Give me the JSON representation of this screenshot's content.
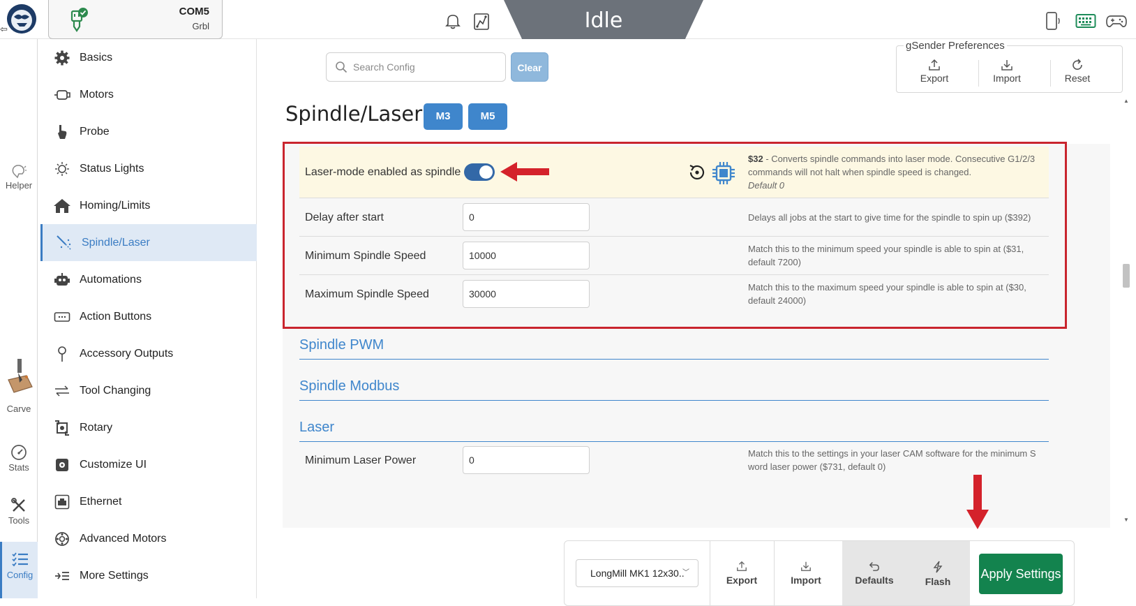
{
  "header": {
    "com_port": "COM5",
    "firmware": "Grbl",
    "machine_state": "Idle",
    "icons": [
      "bell-icon",
      "gcode-icon",
      "phone-icon",
      "keyboard-icon",
      "gamepad-icon"
    ]
  },
  "rail": {
    "items": [
      {
        "label": "Helper",
        "icon": "helper-icon"
      },
      {
        "label": "Carve",
        "icon": "carve-icon"
      },
      {
        "label": "Stats",
        "icon": "stats-icon"
      },
      {
        "label": "Tools",
        "icon": "tools-icon"
      },
      {
        "label": "Config",
        "icon": "config-icon",
        "active": true
      }
    ]
  },
  "nav": {
    "items": [
      {
        "label": "Basics",
        "icon": "gear-icon"
      },
      {
        "label": "Motors",
        "icon": "motor-icon"
      },
      {
        "label": "Probe",
        "icon": "probe-icon"
      },
      {
        "label": "Status Lights",
        "icon": "light-icon"
      },
      {
        "label": "Homing/Limits",
        "icon": "home-icon"
      },
      {
        "label": "Spindle/Laser",
        "icon": "spindle-icon",
        "active": true
      },
      {
        "label": "Automations",
        "icon": "robot-icon"
      },
      {
        "label": "Action Buttons",
        "icon": "buttons-icon"
      },
      {
        "label": "Accessory Outputs",
        "icon": "pin-icon"
      },
      {
        "label": "Tool Changing",
        "icon": "swap-icon"
      },
      {
        "label": "Rotary",
        "icon": "rotary-icon"
      },
      {
        "label": "Customize UI",
        "icon": "customize-icon"
      },
      {
        "label": "Ethernet",
        "icon": "ethernet-icon"
      },
      {
        "label": "Advanced Motors",
        "icon": "advanced-motor-icon"
      },
      {
        "label": "More Settings",
        "icon": "more-icon"
      }
    ]
  },
  "search": {
    "placeholder": "Search Config",
    "value": "",
    "clear_label": "Clear"
  },
  "preferences": {
    "title": "gSender Preferences",
    "export_label": "Export",
    "import_label": "Import",
    "reset_label": "Reset"
  },
  "section": {
    "title": "Spindle/Laser",
    "m3_label": "M3",
    "m5_label": "M5"
  },
  "settings": [
    {
      "label": "Laser-mode enabled as spindle",
      "code": "$32",
      "description": " - Converts spindle commands into laser mode. Consecutive G1/2/3 commands will not halt when spindle speed is changed.",
      "default_text": "Default 0",
      "enabled": true
    },
    {
      "label": "Delay after start",
      "value": "0",
      "description": "Delays all jobs at the start to give time for the spindle to spin up ($392)"
    },
    {
      "label": "Minimum Spindle Speed",
      "value": "10000",
      "description": "Match this to the minimum speed your spindle is able to spin at ($31, default 7200)"
    },
    {
      "label": "Maximum Spindle Speed",
      "value": "30000",
      "description": "Match this to the maximum speed your spindle is able to spin at ($30, default 24000)"
    }
  ],
  "subsections": {
    "pwm": "Spindle PWM",
    "modbus": "Spindle Modbus",
    "laser": "Laser"
  },
  "laser_settings": [
    {
      "label": "Minimum Laser Power",
      "value": "0",
      "description": "Match this to the settings in your laser CAM software for the minimum S word laser power ($731, default 0)"
    }
  ],
  "actions": {
    "machine_profile": "LongMill MK1 12x30..",
    "export_label": "Export",
    "import_label": "Import",
    "defaults_label": "Defaults",
    "flash_label": "Flash",
    "apply_label": "Apply Settings"
  },
  "colors": {
    "accent": "#3f86cc",
    "annotation_red": "#c9252e",
    "apply_green": "#13834e",
    "state_tab": "#6c727a"
  }
}
